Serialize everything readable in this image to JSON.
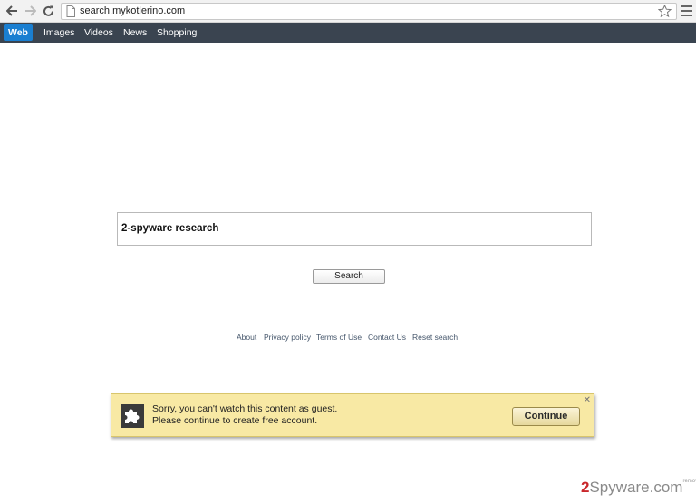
{
  "browser": {
    "url": "search.mykotlerino.com"
  },
  "site_nav": {
    "tabs": [
      {
        "label": "Web",
        "active": true
      },
      {
        "label": "Images",
        "active": false
      },
      {
        "label": "Videos",
        "active": false
      },
      {
        "label": "News",
        "active": false
      },
      {
        "label": "Shopping",
        "active": false
      }
    ]
  },
  "search": {
    "query": "2-spyware research",
    "button_label": "Search"
  },
  "footer": {
    "links": [
      "About",
      "Privacy policy",
      "Terms of Use",
      "Contact Us",
      "Reset search"
    ]
  },
  "notification": {
    "line1": "Sorry, you can't watch this content as guest.",
    "line2": "Please continue to create free account.",
    "button_label": "Continue",
    "close_glyph": "✕"
  },
  "watermark": {
    "prefix": "2",
    "text": "Spyware",
    "suffix": ".com",
    "sup": "remove"
  },
  "colors": {
    "nav_bg": "#3a4450",
    "active_tab": "#1a7fd1",
    "notify_bg": "#f8e9a4"
  }
}
